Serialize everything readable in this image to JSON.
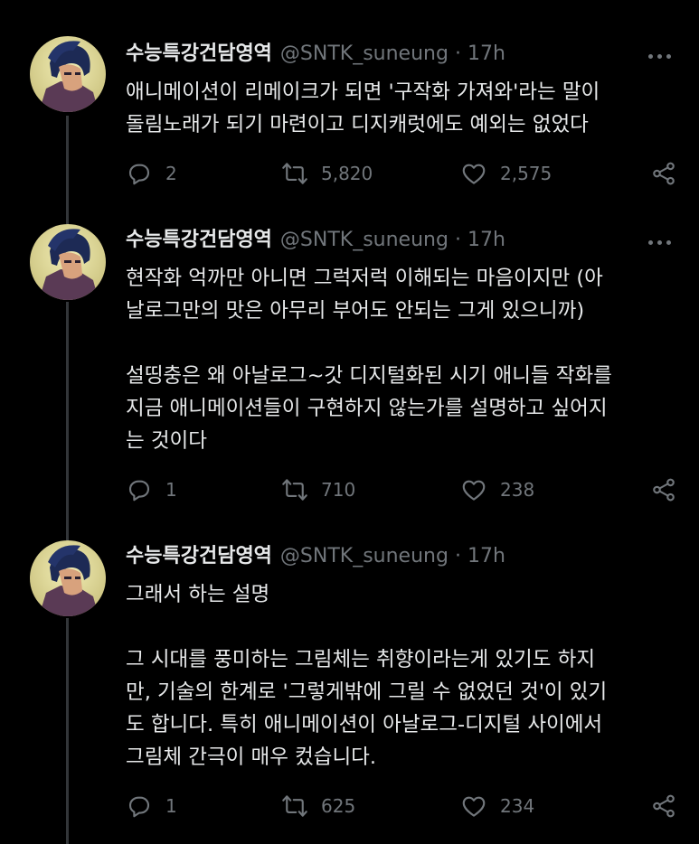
{
  "colors": {
    "background": "#000000",
    "text": "#e7e9ea",
    "muted": "#71767b",
    "thread_line": "#333639"
  },
  "tweets": [
    {
      "name": "수능특강건담영역",
      "handle": "@SNTK_suneung",
      "separator": "·",
      "time": "17h",
      "paragraphs": [
        "애니메이션이 리메이크가 되면 '구작화 가져와'라는 말이\n돌림노래가 되기 마련이고 디지캐럿에도 예외는 없었다"
      ],
      "replies": "2",
      "retweets": "5,820",
      "likes": "2,575",
      "icons": [
        "reply-icon",
        "retweet-icon",
        "like-icon",
        "share-icon"
      ]
    },
    {
      "name": "수능특강건담영역",
      "handle": "@SNTK_suneung",
      "separator": "·",
      "time": "17h",
      "paragraphs": [
        "현작화 억까만 아니면 그럭저럭 이해되는 마음이지만 (아\n날로그만의 맛은 아무리 부어도 안되는 그게 있으니까)",
        "설띵충은 왜 아날로그~갓 디지털화된 시기 애니들 작화를\n지금 애니메이션들이 구현하지 않는가를 설명하고 싶어지\n는 것이다"
      ],
      "replies": "1",
      "retweets": "710",
      "likes": "238",
      "icons": [
        "reply-icon",
        "retweet-icon",
        "like-icon",
        "share-icon"
      ]
    },
    {
      "name": "수능특강건담영역",
      "handle": "@SNTK_suneung",
      "separator": "·",
      "time": "17h",
      "paragraphs": [
        "그래서 하는 설명",
        "그 시대를 풍미하는 그림체는 취향이라는게 있기도 하지\n만, 기술의 한계로 '그렇게밖에 그릴 수 없었던 것'이 있기\n도 합니다. 특히 애니메이션이 아날로그-디지털 사이에서\n그림체 간극이 매우 컸습니다."
      ],
      "replies": "1",
      "retweets": "625",
      "likes": "234",
      "icons": [
        "reply-icon",
        "retweet-icon",
        "like-icon",
        "share-icon"
      ]
    }
  ]
}
